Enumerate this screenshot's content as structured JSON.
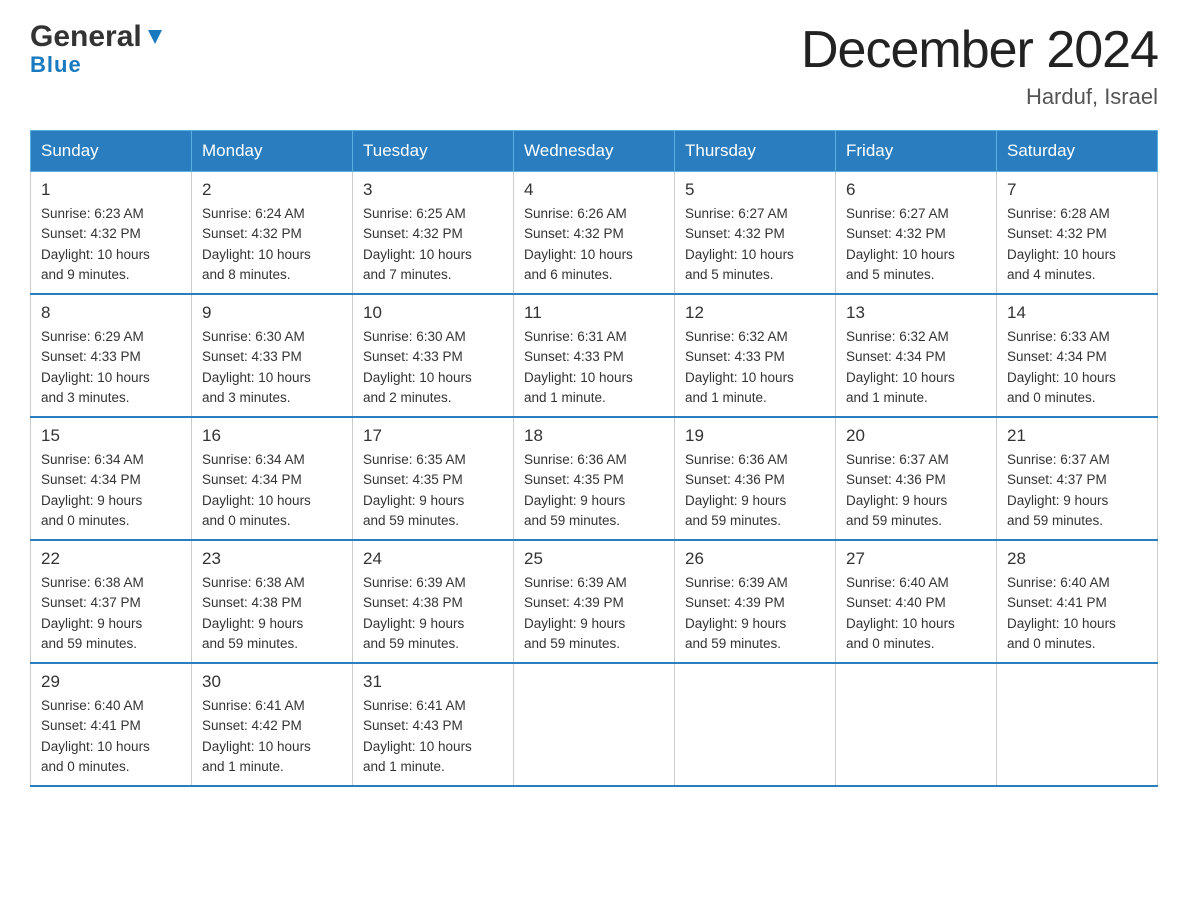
{
  "header": {
    "logo_general": "General",
    "logo_blue": "Blue",
    "title": "December 2024",
    "location": "Harduf, Israel"
  },
  "weekdays": [
    "Sunday",
    "Monday",
    "Tuesday",
    "Wednesday",
    "Thursday",
    "Friday",
    "Saturday"
  ],
  "weeks": [
    [
      {
        "day": "1",
        "sunrise": "6:23 AM",
        "sunset": "4:32 PM",
        "daylight": "10 hours and 9 minutes."
      },
      {
        "day": "2",
        "sunrise": "6:24 AM",
        "sunset": "4:32 PM",
        "daylight": "10 hours and 8 minutes."
      },
      {
        "day": "3",
        "sunrise": "6:25 AM",
        "sunset": "4:32 PM",
        "daylight": "10 hours and 7 minutes."
      },
      {
        "day": "4",
        "sunrise": "6:26 AM",
        "sunset": "4:32 PM",
        "daylight": "10 hours and 6 minutes."
      },
      {
        "day": "5",
        "sunrise": "6:27 AM",
        "sunset": "4:32 PM",
        "daylight": "10 hours and 5 minutes."
      },
      {
        "day": "6",
        "sunrise": "6:27 AM",
        "sunset": "4:32 PM",
        "daylight": "10 hours and 5 minutes."
      },
      {
        "day": "7",
        "sunrise": "6:28 AM",
        "sunset": "4:32 PM",
        "daylight": "10 hours and 4 minutes."
      }
    ],
    [
      {
        "day": "8",
        "sunrise": "6:29 AM",
        "sunset": "4:33 PM",
        "daylight": "10 hours and 3 minutes."
      },
      {
        "day": "9",
        "sunrise": "6:30 AM",
        "sunset": "4:33 PM",
        "daylight": "10 hours and 3 minutes."
      },
      {
        "day": "10",
        "sunrise": "6:30 AM",
        "sunset": "4:33 PM",
        "daylight": "10 hours and 2 minutes."
      },
      {
        "day": "11",
        "sunrise": "6:31 AM",
        "sunset": "4:33 PM",
        "daylight": "10 hours and 1 minute."
      },
      {
        "day": "12",
        "sunrise": "6:32 AM",
        "sunset": "4:33 PM",
        "daylight": "10 hours and 1 minute."
      },
      {
        "day": "13",
        "sunrise": "6:32 AM",
        "sunset": "4:34 PM",
        "daylight": "10 hours and 1 minute."
      },
      {
        "day": "14",
        "sunrise": "6:33 AM",
        "sunset": "4:34 PM",
        "daylight": "10 hours and 0 minutes."
      }
    ],
    [
      {
        "day": "15",
        "sunrise": "6:34 AM",
        "sunset": "4:34 PM",
        "daylight": "9 hours and 0 minutes."
      },
      {
        "day": "16",
        "sunrise": "6:34 AM",
        "sunset": "4:34 PM",
        "daylight": "10 hours and 0 minutes."
      },
      {
        "day": "17",
        "sunrise": "6:35 AM",
        "sunset": "4:35 PM",
        "daylight": "9 hours and 59 minutes."
      },
      {
        "day": "18",
        "sunrise": "6:36 AM",
        "sunset": "4:35 PM",
        "daylight": "9 hours and 59 minutes."
      },
      {
        "day": "19",
        "sunrise": "6:36 AM",
        "sunset": "4:36 PM",
        "daylight": "9 hours and 59 minutes."
      },
      {
        "day": "20",
        "sunrise": "6:37 AM",
        "sunset": "4:36 PM",
        "daylight": "9 hours and 59 minutes."
      },
      {
        "day": "21",
        "sunrise": "6:37 AM",
        "sunset": "4:37 PM",
        "daylight": "9 hours and 59 minutes."
      }
    ],
    [
      {
        "day": "22",
        "sunrise": "6:38 AM",
        "sunset": "4:37 PM",
        "daylight": "9 hours and 59 minutes."
      },
      {
        "day": "23",
        "sunrise": "6:38 AM",
        "sunset": "4:38 PM",
        "daylight": "9 hours and 59 minutes."
      },
      {
        "day": "24",
        "sunrise": "6:39 AM",
        "sunset": "4:38 PM",
        "daylight": "9 hours and 59 minutes."
      },
      {
        "day": "25",
        "sunrise": "6:39 AM",
        "sunset": "4:39 PM",
        "daylight": "9 hours and 59 minutes."
      },
      {
        "day": "26",
        "sunrise": "6:39 AM",
        "sunset": "4:39 PM",
        "daylight": "9 hours and 59 minutes."
      },
      {
        "day": "27",
        "sunrise": "6:40 AM",
        "sunset": "4:40 PM",
        "daylight": "10 hours and 0 minutes."
      },
      {
        "day": "28",
        "sunrise": "6:40 AM",
        "sunset": "4:41 PM",
        "daylight": "10 hours and 0 minutes."
      }
    ],
    [
      {
        "day": "29",
        "sunrise": "6:40 AM",
        "sunset": "4:41 PM",
        "daylight": "10 hours and 0 minutes."
      },
      {
        "day": "30",
        "sunrise": "6:41 AM",
        "sunset": "4:42 PM",
        "daylight": "10 hours and 1 minute."
      },
      {
        "day": "31",
        "sunrise": "6:41 AM",
        "sunset": "4:43 PM",
        "daylight": "10 hours and 1 minute."
      },
      null,
      null,
      null,
      null
    ]
  ],
  "labels": {
    "sunrise": "Sunrise:",
    "sunset": "Sunset:",
    "daylight": "Daylight:"
  }
}
